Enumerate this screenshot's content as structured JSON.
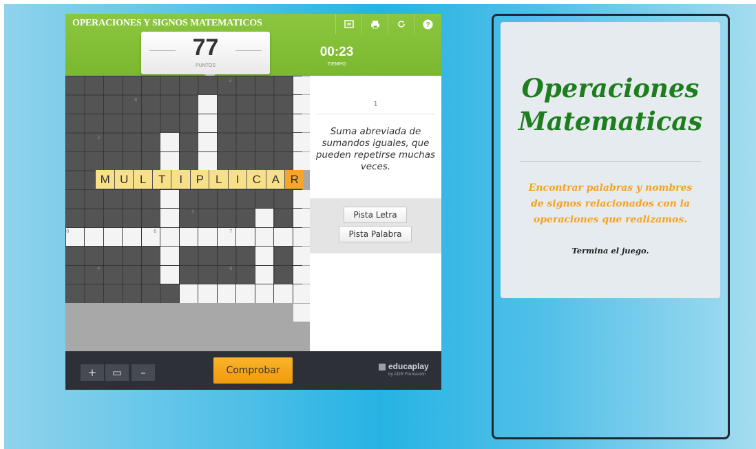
{
  "game": {
    "title": "OPERACIONES Y SIGNOS MATEMATICOS",
    "toolbar_icons": [
      "fullscreen-icon",
      "print-icon",
      "restart-icon",
      "help-icon"
    ],
    "score": {
      "value": "77",
      "label": "PUNTOS"
    },
    "time": {
      "value": "00:23",
      "label": "TIEMPO"
    },
    "board": {
      "word": [
        "M",
        "U",
        "L",
        "T",
        "I",
        "P",
        "L",
        "I",
        "C",
        "A",
        "R"
      ],
      "clue_numbers": [
        "3",
        "8",
        "2",
        "5",
        "0",
        "6",
        "7",
        "4",
        "9"
      ]
    },
    "clue": {
      "number": "1",
      "text": "Suma abreviada de sumandos iguales, que pueden repetirse muchas veces."
    },
    "hints": {
      "letter": "Pista Letra",
      "word": "Pista Palabra"
    },
    "zoom": {
      "in": "+",
      "reset": "▭",
      "out": "–"
    },
    "check_button": "Comprobar",
    "brand": {
      "name": "educaplay",
      "sub": "by ADR Formación"
    },
    "colors": {
      "header": "#8cc63f",
      "check": "#f5a623",
      "highlight": "#f8e08a"
    }
  },
  "info": {
    "title": "Operaciones Matematicas",
    "description": "Encontrar palabras y nombres de signos relacionados con la operaciones que realizamos.",
    "footer": "Termina el juego.",
    "colors": {
      "title": "#1e7d1e",
      "description": "#f6a21e"
    }
  }
}
